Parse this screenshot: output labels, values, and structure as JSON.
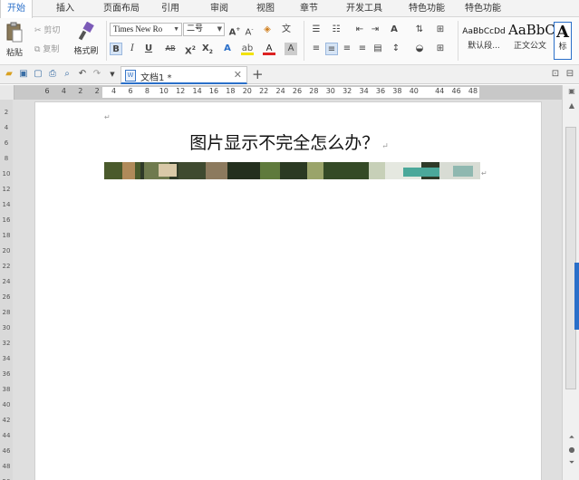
{
  "menu": {
    "tabs": [
      "开始",
      "插入",
      "页面布局",
      "引用",
      "审阅",
      "视图",
      "章节",
      "开发工具",
      "特色功能",
      "特色功能"
    ]
  },
  "ribbon": {
    "paste": "粘贴",
    "cut": "剪切",
    "copy": "复制",
    "format_painter": "格式刷",
    "font_name": "Times New Ro",
    "font_size": "二号",
    "styles": [
      {
        "sample": "AaBbCcDd",
        "name": "默认段..."
      },
      {
        "sample": "AaBbC",
        "name": "正文公文"
      },
      {
        "sample": "A",
        "name": "标"
      }
    ]
  },
  "doc_tab": {
    "title": "文档1 *"
  },
  "ruler": {
    "h_numbers": [
      "6",
      "4",
      "2",
      "2",
      "4",
      "6",
      "8",
      "10",
      "12",
      "14",
      "16",
      "18",
      "20",
      "22",
      "24",
      "26",
      "28",
      "30",
      "32",
      "34",
      "36",
      "38",
      "40",
      "44",
      "46",
      "48"
    ],
    "v_numbers": [
      "2",
      "4",
      "6",
      "8",
      "10",
      "12",
      "14",
      "16",
      "18",
      "20",
      "22",
      "24",
      "26",
      "28",
      "30",
      "32",
      "34",
      "36",
      "38",
      "40",
      "42",
      "44",
      "46",
      "48",
      "50"
    ]
  },
  "document": {
    "heading": "图片显示不完全怎么办？",
    "paragraph_mark": "↵"
  },
  "colors": {
    "accent": "#2a6fc9"
  }
}
